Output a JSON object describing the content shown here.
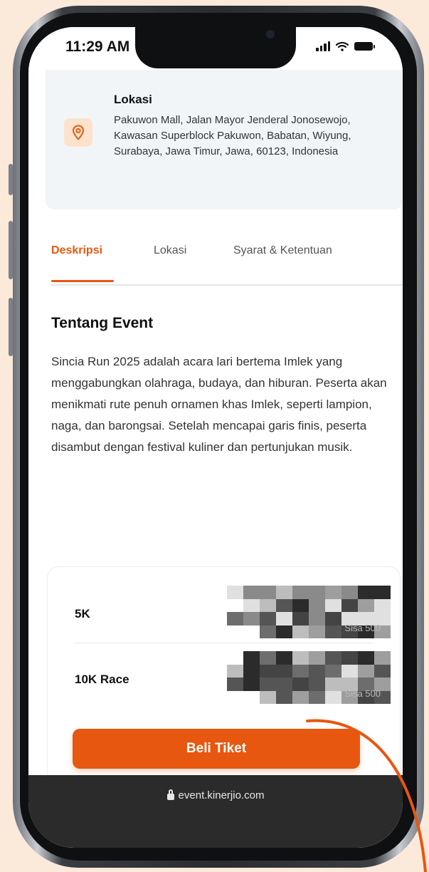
{
  "status_bar": {
    "time": "11:29 AM"
  },
  "location_card": {
    "title": "Lokasi",
    "address": "Pakuwon Mall, Jalan Mayor Jenderal Jonosewojo, Kawasan Superblock Pakuwon, Babatan, Wiyung, Surabaya, Jawa Timur, Jawa, 60123, Indonesia",
    "icon": "location-pin-icon"
  },
  "tabs": [
    {
      "label": "Deskripsi",
      "active": true
    },
    {
      "label": "Lokasi",
      "active": false
    },
    {
      "label": "Syarat & Ketentuan",
      "active": false
    }
  ],
  "about": {
    "title": "Tentang Event",
    "body": "Sincia Run 2025 adalah acara lari bertema Imlek yang menggabungkan olahraga, budaya, dan hiburan. Peserta akan menikmati rute penuh ornamen khas Imlek, seperti lampion, naga, dan barongsai. Setelah mencapai garis finis, peserta disambut dengan festival kuliner dan pertunjukan musik."
  },
  "tickets": [
    {
      "name": "5K",
      "remaining_label": "Sisa 500"
    },
    {
      "name": "10K Race",
      "remaining_label": "Sisa 500"
    }
  ],
  "buy_button": {
    "label": "Beli Tiket"
  },
  "browser": {
    "url": "event.kinerjio.com"
  },
  "colors": {
    "accent": "#e8570f",
    "background": "#fbe9da",
    "card": "#f2f5f8",
    "url_bar": "#2b2b2b"
  }
}
